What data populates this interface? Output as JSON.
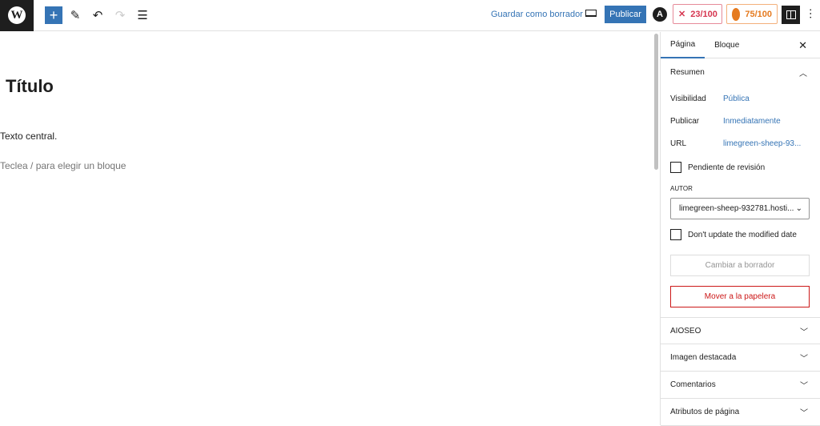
{
  "toolbar": {
    "wp_logo": "W",
    "add": "+",
    "save_draft": "Guardar como borrador",
    "publish": "Publicar",
    "astra": "A",
    "seo_score": "23/100",
    "readability_score": "75/100"
  },
  "editor": {
    "title": "Título",
    "paragraph": "Texto central.",
    "placeholder": "Teclea / para elegir un bloque"
  },
  "sidebar": {
    "tabs": [
      "Página",
      "Bloque"
    ],
    "summary": {
      "heading": "Resumen",
      "rows": [
        {
          "k": "Visibilidad",
          "v": "Pública"
        },
        {
          "k": "Publicar",
          "v": "Inmediatamente"
        },
        {
          "k": "URL",
          "v": "limegreen-sheep-93..."
        }
      ],
      "pending": "Pendiente de revisión",
      "author_label": "Autor",
      "author": "limegreen-sheep-932781.hosti...",
      "no_update": "Don't update the modified date",
      "switch_draft": "Cambiar a borrador",
      "trash": "Mover a la papelera"
    },
    "sections": [
      "AIOSEO",
      "Imagen destacada",
      "Comentarios",
      "Atributos de página"
    ]
  }
}
